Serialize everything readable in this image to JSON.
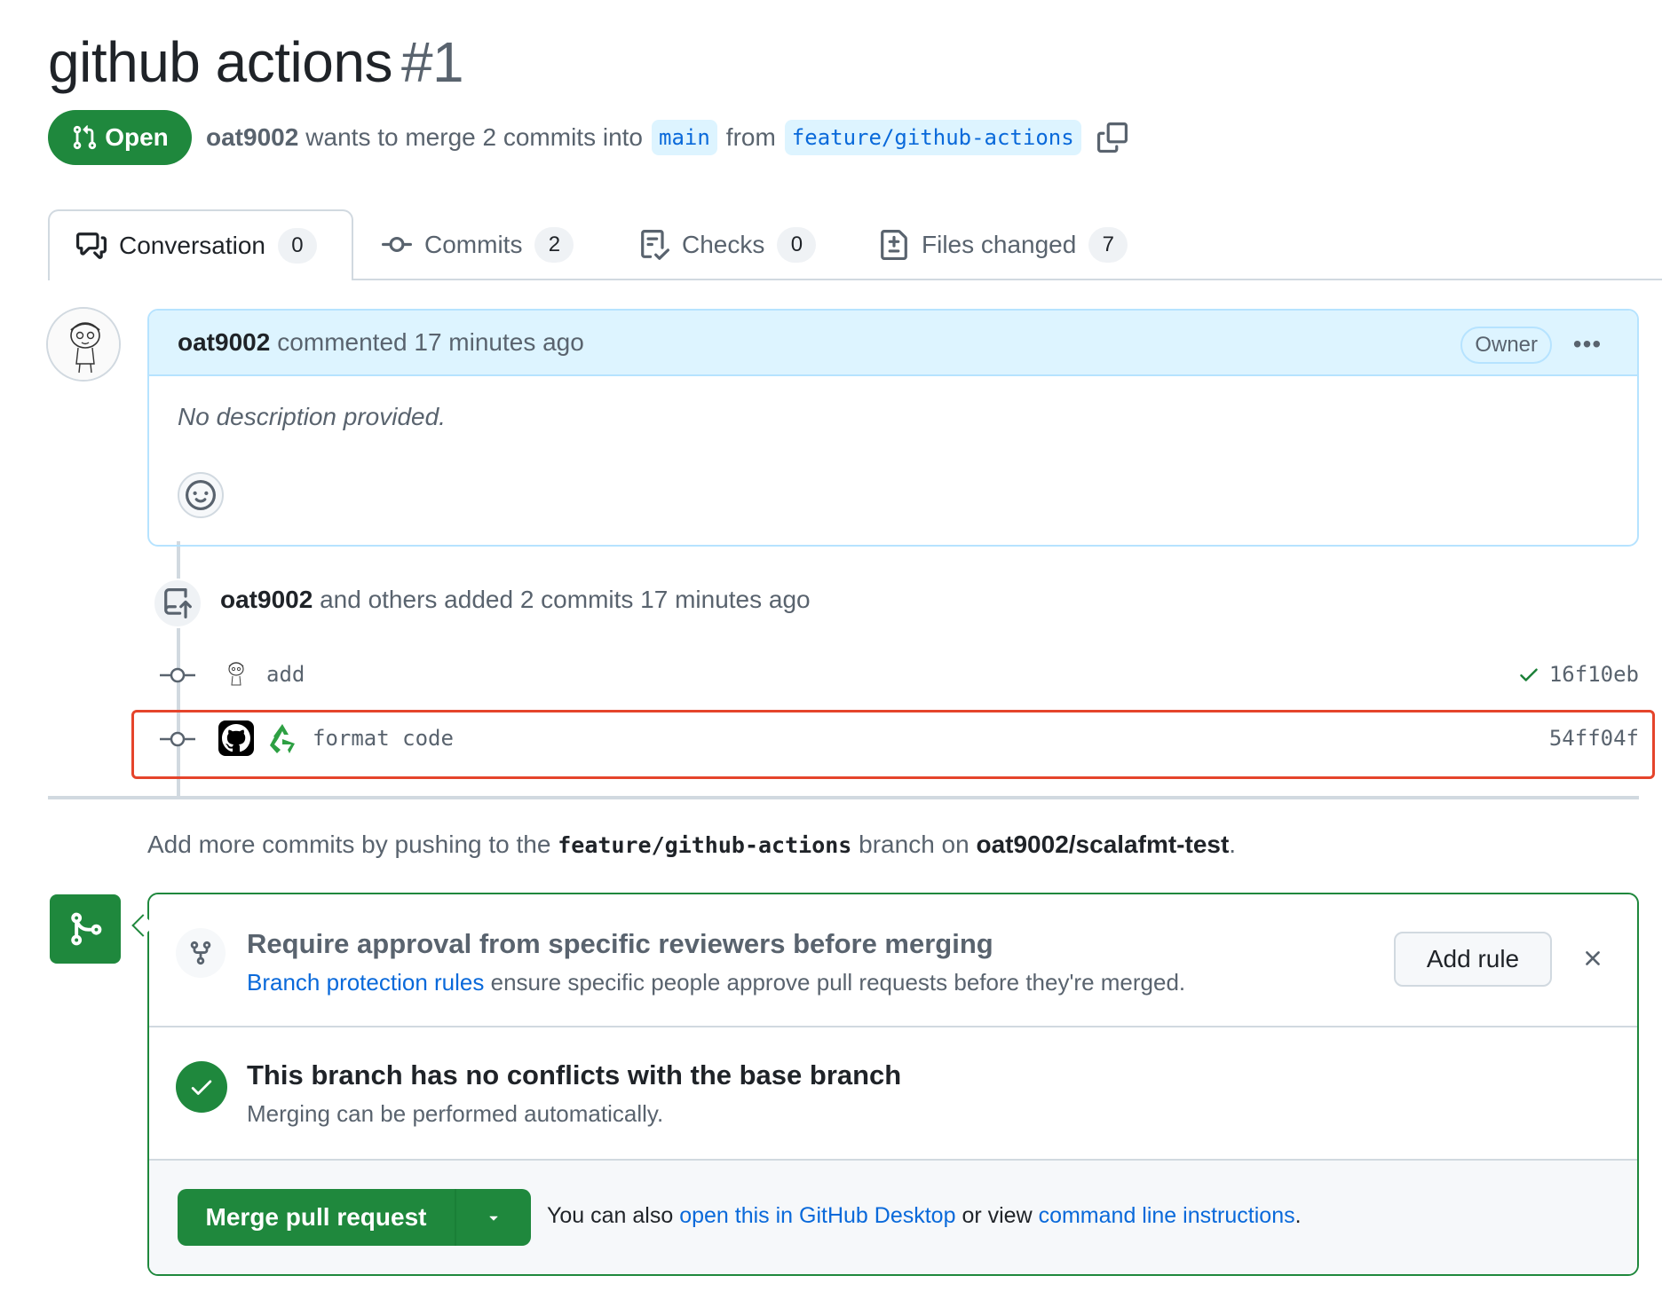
{
  "pr": {
    "title": "github actions",
    "number": "#1",
    "state": "Open",
    "author": "oat9002",
    "merge_text_1": "wants to merge 2 commits into",
    "base_branch": "main",
    "merge_text_2": "from",
    "head_branch": "feature/github-actions"
  },
  "tabs": [
    {
      "label": "Conversation",
      "count": "0"
    },
    {
      "label": "Commits",
      "count": "2"
    },
    {
      "label": "Checks",
      "count": "0"
    },
    {
      "label": "Files changed",
      "count": "7"
    }
  ],
  "comment": {
    "author": "oat9002",
    "action": "commented 17 minutes ago",
    "badge": "Owner",
    "body": "No description provided."
  },
  "push_event": {
    "author": "oat9002",
    "text": "and others added 2 commits 17 minutes ago"
  },
  "commits": [
    {
      "message": "add",
      "sha": "16f10eb",
      "status": "success"
    },
    {
      "message": "format code",
      "sha": "54ff04f"
    }
  ],
  "more_commits": {
    "prefix": "Add more commits by pushing to the",
    "branch": "feature/github-actions",
    "middle": "branch on",
    "repo": "oat9002/scalafmt-test",
    "suffix": "."
  },
  "protection": {
    "title": "Require approval from specific reviewers before merging",
    "link": "Branch protection rules",
    "text": "ensure specific people approve pull requests before they're merged.",
    "add_rule": "Add rule"
  },
  "conflicts": {
    "title": "This branch has no conflicts with the base branch",
    "sub": "Merging can be performed automatically."
  },
  "merge": {
    "button": "Merge pull request",
    "text_1": "You can also",
    "link_1": "open this in GitHub Desktop",
    "text_2": "or view",
    "link_2": "command line instructions",
    "text_3": "."
  },
  "colors": {
    "green": "#1f883d",
    "blue_link": "#0969da",
    "highlight": "#e5442b"
  }
}
